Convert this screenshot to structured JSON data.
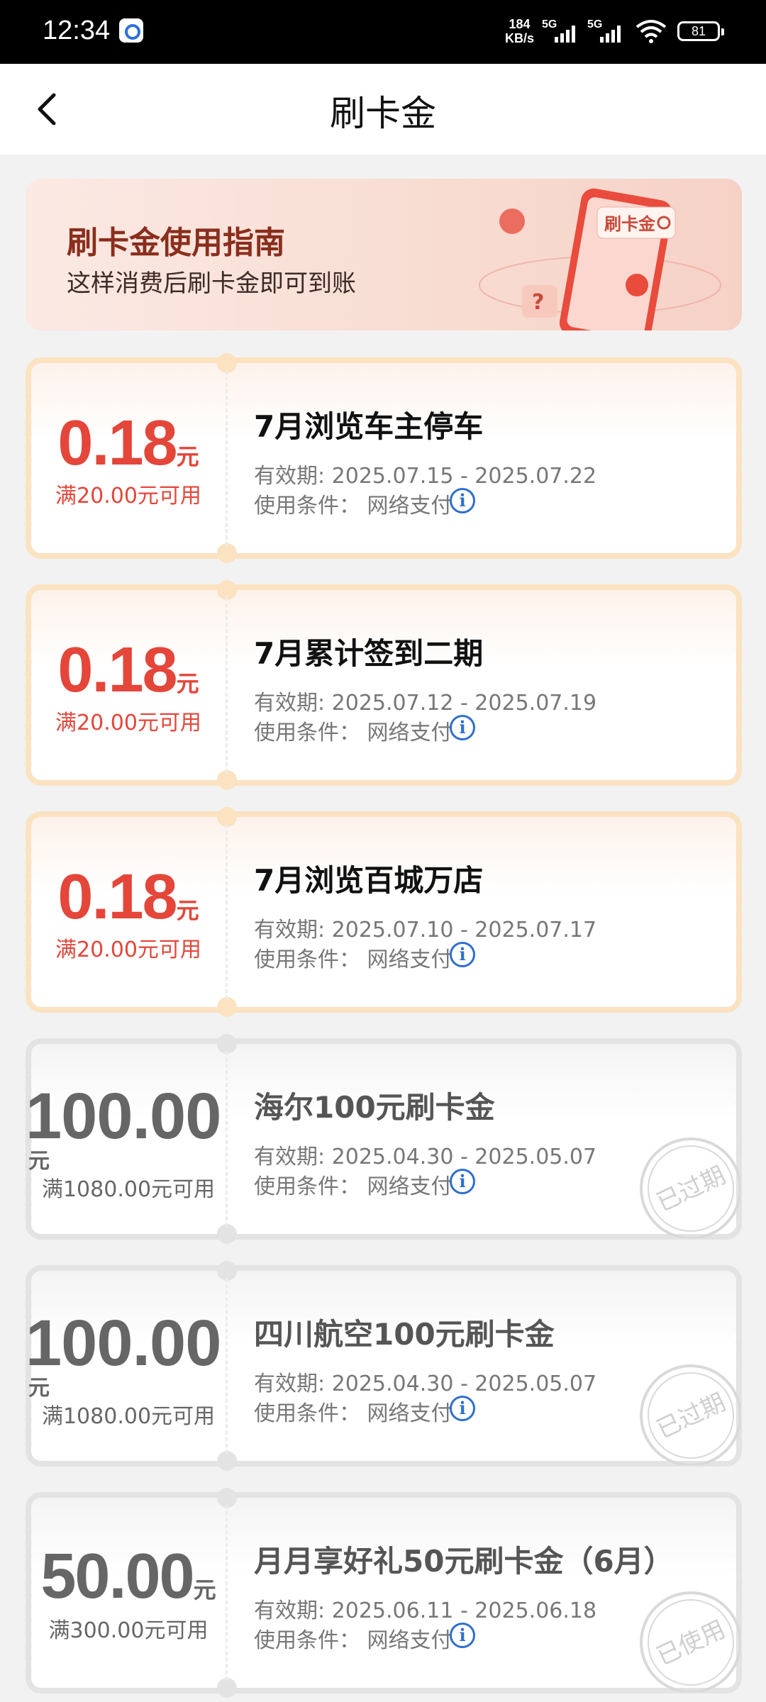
{
  "status_bar": {
    "time": "12:34",
    "speed_top": "184",
    "speed_bottom": "KB/s",
    "net1": "5G",
    "net2": "5G",
    "battery": "81"
  },
  "header": {
    "title": "刷卡金",
    "back_icon": "chevron-left-icon"
  },
  "banner": {
    "title": "刷卡金使用指南",
    "subtitle": "这样消费后刷卡金即可到账",
    "phone_label": "刷卡金"
  },
  "coupons": [
    {
      "amount": "0.18",
      "unit": "元",
      "condition": "满20.00元可用",
      "name": "7月浏览车主停车",
      "validity": "有效期: 2025.07.15 - 2025.07.22",
      "usage": "使用条件： 网络支付",
      "state": "active"
    },
    {
      "amount": "0.18",
      "unit": "元",
      "condition": "满20.00元可用",
      "name": "7月累计签到二期",
      "validity": "有效期: 2025.07.12 - 2025.07.19",
      "usage": "使用条件： 网络支付",
      "state": "active"
    },
    {
      "amount": "0.18",
      "unit": "元",
      "condition": "满20.00元可用",
      "name": "7月浏览百城万店",
      "validity": "有效期: 2025.07.10 - 2025.07.17",
      "usage": "使用条件： 网络支付",
      "state": "active"
    },
    {
      "amount": "100.00",
      "unit": "元",
      "condition": "满1080.00元可用",
      "name": "海尔100元刷卡金",
      "validity": "有效期: 2025.04.30 - 2025.05.07",
      "usage": "使用条件： 网络支付",
      "state": "expired",
      "stamp": "已过期"
    },
    {
      "amount": "100.00",
      "unit": "元",
      "condition": "满1080.00元可用",
      "name": "四川航空100元刷卡金",
      "validity": "有效期: 2025.04.30 - 2025.05.07",
      "usage": "使用条件： 网络支付",
      "state": "expired",
      "stamp": "已过期"
    },
    {
      "amount": "50.00",
      "unit": "元",
      "condition": "满300.00元可用",
      "name": "月月享好礼50元刷卡金（6月）",
      "validity": "有效期: 2025.06.11 - 2025.06.18",
      "usage": "使用条件： 网络支付",
      "state": "used",
      "stamp": "已使用"
    }
  ],
  "colors": {
    "accent_red": "#e4463a",
    "info_blue": "#2e6fd0",
    "coupon_border_active": "#fbe2c1",
    "coupon_border_inactive": "#e3e3e3"
  }
}
